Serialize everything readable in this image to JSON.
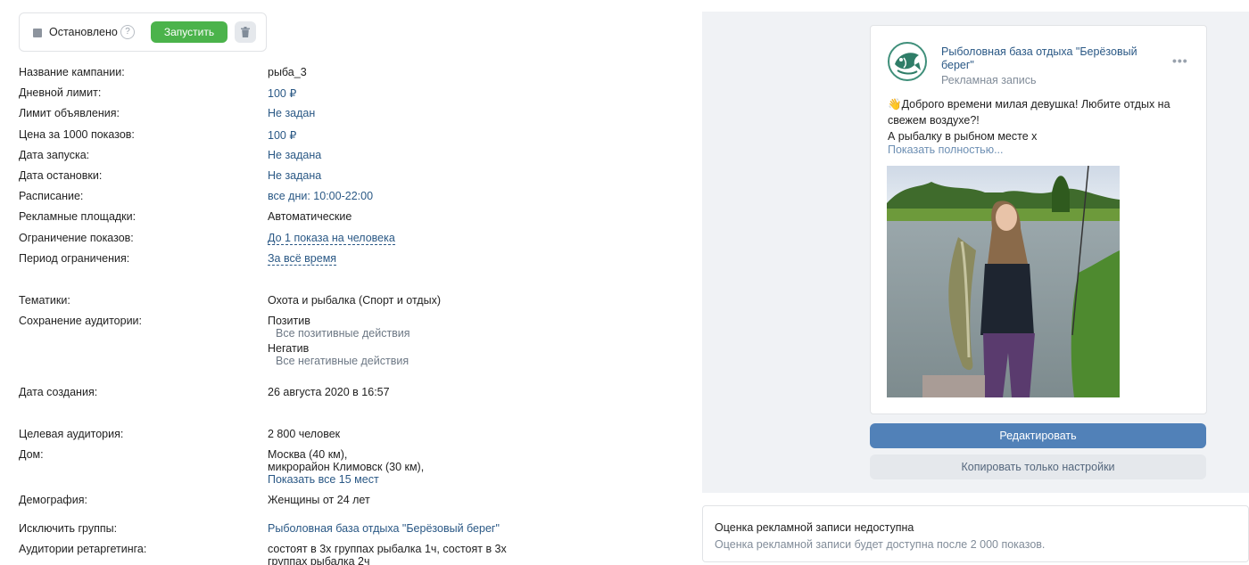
{
  "status": {
    "label": "Остановлено",
    "help": "?",
    "start_label": "Запустить",
    "icons": {
      "status": "stopped-square-icon",
      "help": "help-icon",
      "delete": "trash-icon"
    }
  },
  "details": [
    {
      "label": "Название кампании:",
      "value": "рыба_3"
    },
    {
      "label": "Дневной лимит:",
      "value": "100 ₽"
    },
    {
      "label": "Лимит объявления:",
      "value": "Не задан"
    },
    {
      "label": "Цена за 1000 показов:",
      "value": "100 ₽"
    },
    {
      "label": "Дата запуска:",
      "value": "Не задана"
    },
    {
      "label": "Дата остановки:",
      "value": "Не задана"
    },
    {
      "label": "Расписание:",
      "value": "все дни: 10:00-22:00"
    },
    {
      "label": "Рекламные площадки:",
      "value": "Автоматические"
    },
    {
      "label": "Ограничение показов:",
      "value": "До 1 показа на человека"
    },
    {
      "label": "Период ограничения:",
      "value": "За всё время"
    },
    {
      "label": "Тематики:",
      "value": "Охота и рыбалка (Спорт и отдых)"
    },
    {
      "label": "Сохранение аудитории:",
      "value": "Позитив",
      "sub": "Все позитивные действия",
      "value2": "Негатив",
      "sub2": "Все негативные действия"
    },
    {
      "label": "Дата создания:",
      "value": "26 августа 2020 в 16:57"
    },
    {
      "label": "Целевая аудитория:",
      "value": "2 800 человек"
    },
    {
      "label": "Дом:",
      "value": "Москва (40 км),",
      "value2": "микрорайон Климовск (30 км),",
      "link": "Показать все 15 мест"
    },
    {
      "label": "Демография:",
      "value": "Женщины от 24 лет"
    },
    {
      "label": "Исключить группы:",
      "value": "Рыболовная база отдыха \"Берёзовый берег\""
    },
    {
      "label": "Аудитории ретаргетинга:",
      "value": "состоят в 3х группах рыбалка 1ч, состоят в 3х",
      "value2": "группах рыбалка 2ч"
    }
  ],
  "ad": {
    "name": "Рыболовная база отдыха \"Берёзовый берег\"",
    "subtitle": "Рекламная запись",
    "text_line1": "Доброго времени милая девушка! Любите отдых на",
    "text_line2": "свежем воздухе?!",
    "text_line3": "А рыбалку в рыбном месте х",
    "show_more": "Показать полностью...",
    "emoji_icon": "waving-hand-icon",
    "image_description_icon": "photo-woman-with-pike-icon"
  },
  "buttons": {
    "edit": "Редактировать",
    "copy": "Копировать только настройки"
  },
  "rating": {
    "title": "Оценка рекламной записи недоступна",
    "text": "Оценка рекламной записи будет доступна после 2 000 показов."
  },
  "colors": {
    "accent": "#5181b8",
    "link": "#2a5885",
    "success": "#4bb34b",
    "panel": "#f0f2f5"
  }
}
